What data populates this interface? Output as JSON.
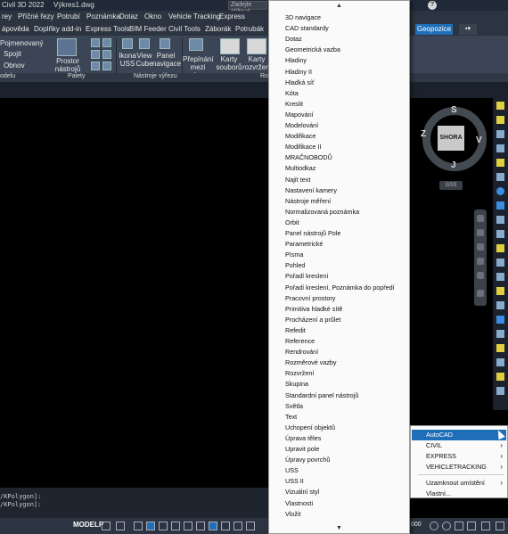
{
  "titlebar": {
    "app": "Civil 3D 2022",
    "file": "Výkres1.dwg",
    "search_placeholder": "Zadejte klíčové"
  },
  "menubar": {
    "items": [
      "rey",
      "Příčné řezy",
      "Potrubí",
      "Poznámka",
      "Dotaz",
      "Okno",
      "Vehicle Tracking",
      "Express"
    ]
  },
  "ribbontabs": {
    "items": [
      "ápověda",
      "Doplňky add-in",
      "Express Tools",
      "BIM Feeder",
      "Civil Tools",
      "Záborák",
      "Potrubák"
    ],
    "active": "Geopozice"
  },
  "ribbon": {
    "left_items": [
      "Pojmenovaný",
      "Spojit",
      "Obnov"
    ],
    "left_footer": "odelu",
    "prostor": "Prostor nástrojů",
    "palety": "Palety",
    "ikona_ucs": [
      "Ikona",
      "USS"
    ],
    "view_cube": [
      "View",
      "Cube"
    ],
    "panel_navigace": [
      "Panel",
      "navigace"
    ],
    "nastroje_footer": "Nástroje výřezu",
    "prepinani": [
      "Přepínání",
      "mezi okny"
    ],
    "karty_souboru": [
      "Karty",
      "souborů"
    ],
    "karty_rozvrzeni": [
      "Karty",
      "rozvržení"
    ],
    "ro_footer": "Ro"
  },
  "viewcube": {
    "face": "SHORA",
    "north": "S",
    "south": "J",
    "east": "V",
    "west": "Z",
    "wcs": "GSS"
  },
  "cmdline": {
    "lines": [
      "/KPolygon]:",
      "/KPolygon]:"
    ]
  },
  "statusbar": {
    "modelp": "MODELP",
    "scale": "000"
  },
  "ctxmenu": {
    "items": [
      "3D navigace",
      "CAD standardy",
      "Dotaz",
      "Geometrická vazba",
      "Hladiny",
      "Hladiny II",
      "Hladká síť",
      "Kóta",
      "Kreslit",
      "Mapování",
      "Modelování",
      "Modifikace",
      "Modifikace II",
      "MRAČNOBODŮ",
      "Multiodkaz",
      "Najít text",
      "Nastavení kamery",
      "Nástroje měření",
      "Normalizovaná poznámka",
      "Orbit",
      "Panel nástrojů Pole",
      "Parametrické",
      "Písma",
      "Pohled",
      "Pořadí kreslení",
      "Pořadí kreslení, Poznámka do popředí",
      "Pracovní prostory",
      "Primitiva hladké sítě",
      "Procházení a průlet",
      "Refedit",
      "Reference",
      "Rendrování",
      "Rozměrové vazby",
      "Rozvržení",
      "Skupina",
      "Standardní panel nástrojů",
      "Světla",
      "Text",
      "Uchopení objektů",
      "Úprava těles",
      "Upravit pole",
      "Úpravy povrchů",
      "USS",
      "USS II",
      "Vizuální styl",
      "Vlastnosti",
      "Vložit"
    ]
  },
  "submenu": {
    "items": [
      {
        "label": "AutoCAD",
        "arrow": "›"
      },
      {
        "label": "CIVIL",
        "arrow": "›"
      },
      {
        "label": "EXPRESS",
        "arrow": "›"
      },
      {
        "label": "VEHICLETRACKING",
        "arrow": "›"
      },
      {
        "label": "Uzamknout umístění",
        "arrow": "›"
      },
      {
        "label": "Vlastní...",
        "arrow": ""
      }
    ]
  },
  "colors": {
    "accent": "#1f6fb8",
    "ribbon_bg": "#3b4555",
    "menu_bg": "#fafafa"
  }
}
